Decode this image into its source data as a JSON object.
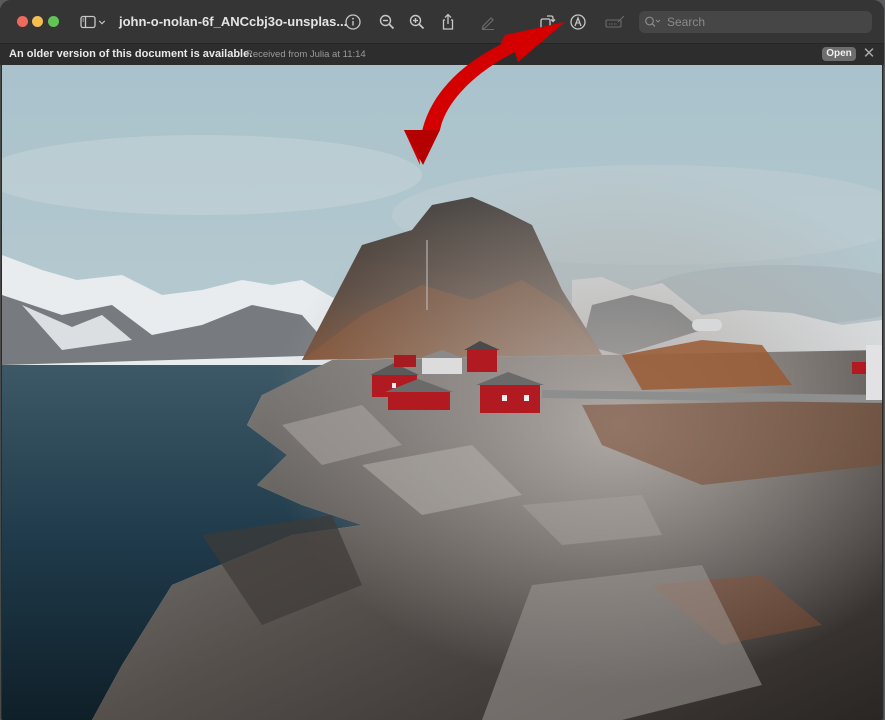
{
  "window": {
    "title": "john-o-nolan-6f_ANCcbj3o-unsplas...",
    "traffic_lights": {
      "close": "#ed6a5e",
      "minimize": "#f4bf4f",
      "maximize": "#61c554"
    }
  },
  "toolbar": {
    "icons": [
      {
        "name": "sidebar-toggle-icon"
      },
      {
        "name": "chevron-down-icon"
      },
      {
        "name": "info-icon"
      },
      {
        "name": "zoom-out-icon"
      },
      {
        "name": "zoom-in-icon"
      },
      {
        "name": "share-icon"
      },
      {
        "name": "highlight-pen-icon"
      },
      {
        "name": "rotate-icon"
      },
      {
        "name": "markup-icon"
      },
      {
        "name": "signature-icon"
      }
    ],
    "search": {
      "placeholder": "Search",
      "value": ""
    }
  },
  "banner": {
    "message": "An older version of this document is available.",
    "detail": "Received from Julia at 11:14",
    "open_label": "Open",
    "close_glyph": "✕"
  },
  "document": {
    "image_alt": "Red fishing cabins on rocky coast beneath a steep mountain peak with snowy ranges and a fjord"
  },
  "annotation": {
    "type": "curved-arrow",
    "color": "#d00000",
    "target": "markup-icon"
  }
}
